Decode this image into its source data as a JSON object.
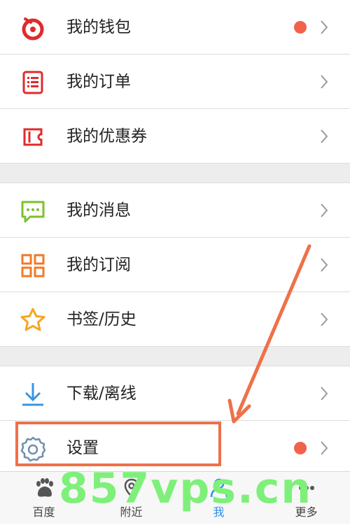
{
  "menu": {
    "wallet": {
      "label": "我的钱包",
      "icon": "wallet-icon",
      "has_badge": true
    },
    "orders": {
      "label": "我的订单",
      "icon": "order-list-icon"
    },
    "coupons": {
      "label": "我的优惠券",
      "icon": "coupon-icon"
    },
    "messages": {
      "label": "我的消息",
      "icon": "message-bubble-icon"
    },
    "subscriptions": {
      "label": "我的订阅",
      "icon": "grid-icon"
    },
    "bookmarks": {
      "label": "书签/历史",
      "icon": "star-icon"
    },
    "downloads": {
      "label": "下载/离线",
      "icon": "download-icon"
    },
    "settings": {
      "label": "设置",
      "icon": "gear-icon",
      "has_badge": true
    }
  },
  "tabbar": {
    "baidu": {
      "label": "百度",
      "icon": "paw-icon"
    },
    "nearby": {
      "label": "附近",
      "icon": "location-pin-icon"
    },
    "me": {
      "label": "我",
      "icon": "person-icon",
      "active": true
    },
    "more": {
      "label": "更多",
      "icon": "more-dots-icon"
    }
  },
  "colors": {
    "badge": "#f2614a",
    "active_tab": "#2c8ef0",
    "highlight_box": "#f07049"
  },
  "watermark": {
    "text": "857vps.cn"
  }
}
